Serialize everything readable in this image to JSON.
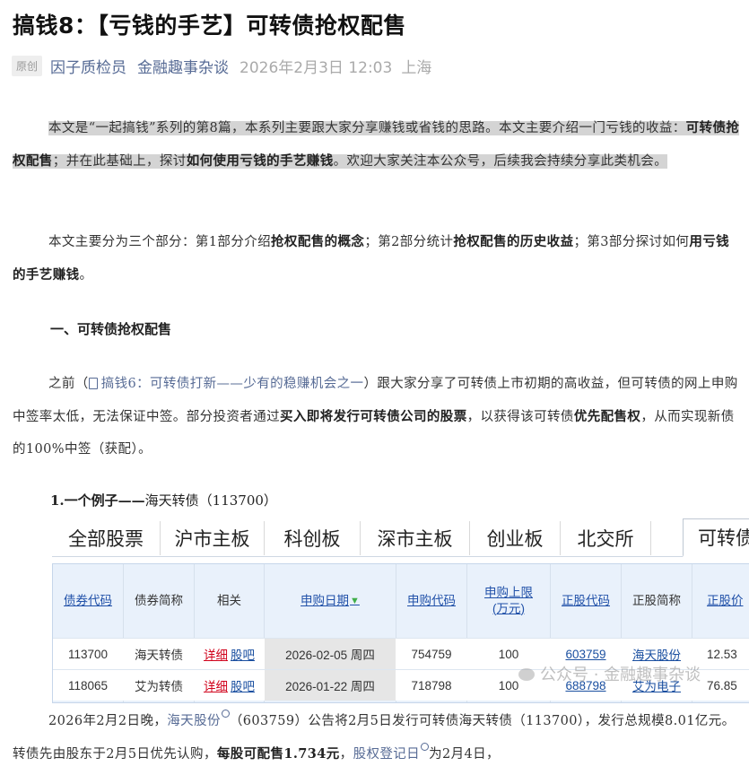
{
  "article": {
    "title": "搞钱8：【亏钱的手艺】可转债抢权配售",
    "tag": "原创",
    "author": "因子质检员",
    "account": "金融趣事杂谈",
    "datetime": "2026年2月3日 12:03",
    "location": "上海"
  },
  "intro": {
    "t1": "本文是“一起搞钱”系列的第8篇，本系列主要跟大家分享赚钱或省钱的思路。本文主要介绍一门亏钱的收益：",
    "b1": "可转债抢权配售",
    "t2": "；并在此基础上，探讨",
    "b2": "如何使用亏钱的手艺赚钱",
    "t3": "。欢迎大家关注本公众号，后续我会持续分享此类机会。"
  },
  "outline": {
    "t1": "本文主要分为三个部分：第1部分介绍",
    "b1": "抢权配售的概念",
    "t2": "；第2部分统计",
    "b2": "抢权配售的历史收益",
    "t3": "；第3部分探讨如何",
    "b3": "用亏钱的手艺赚钱",
    "t4": "。"
  },
  "section1": {
    "heading": "一、可转债抢权配售"
  },
  "before": {
    "t1": "之前（",
    "link": "搞钱6：可转债打新——少有的稳赚机会之一",
    "t2": "）跟大家分享了可转债上市初期的高收益，但可转债的网上申购中签率太低，无法保证中签。部分投资者通过",
    "b1": "买入即将发行可转债公司的股票",
    "t3": "，以获得该可转债",
    "b2": "优先配售权",
    "t4": "，从而实现新债的100%中签（获配）。"
  },
  "example": {
    "heading_bold": "1.一个例子——",
    "heading_rest": "海天转债（113700）"
  },
  "screenshot": {
    "tabs": [
      "全部股票",
      "沪市主板",
      "科创板",
      "深市主板",
      "创业板",
      "北交所",
      "可转债"
    ],
    "columns": [
      "债券代码",
      "债券简称",
      "相关",
      "申购日期",
      "申购代码",
      "申购上限\n(万元)",
      "正股代码",
      "正股简称",
      "正股价"
    ],
    "sort_icon": "arrow-down-icon",
    "rows": [
      {
        "code": "113700",
        "name": "海天转债",
        "detail": "详细",
        "bar": "股吧",
        "date": "2026-02-05 周四",
        "sub_code": "754759",
        "limit": "100",
        "stock_code": "603759",
        "stock_name": "海天股份",
        "price": "12.53"
      },
      {
        "code": "118065",
        "name": "艾为转债",
        "detail": "详细",
        "bar": "股吧",
        "date": "2026-01-22 周四",
        "sub_code": "718798",
        "limit": "100",
        "stock_code": "688798",
        "stock_name": "艾为电子",
        "price": "76.85"
      }
    ],
    "watermark": "公众号 · 金融趣事杂谈"
  },
  "closing": {
    "t1": "2026年2月2日晚，",
    "link1": "海天股份",
    "t2": "（603759）公告将2月5日发行可转债海天转债（113700），发行总规模8.01亿元。转债先由股东于2月5日优先认购，",
    "b1": "每股可配售1.734元",
    "t3": "，",
    "link2": "股权登记日",
    "t4": "为2月4日，"
  },
  "colors": {
    "link": "#576b95",
    "highlight": "#d4d4d4",
    "table_bg": "#e9f1fb",
    "red_link": "#d0021b"
  }
}
